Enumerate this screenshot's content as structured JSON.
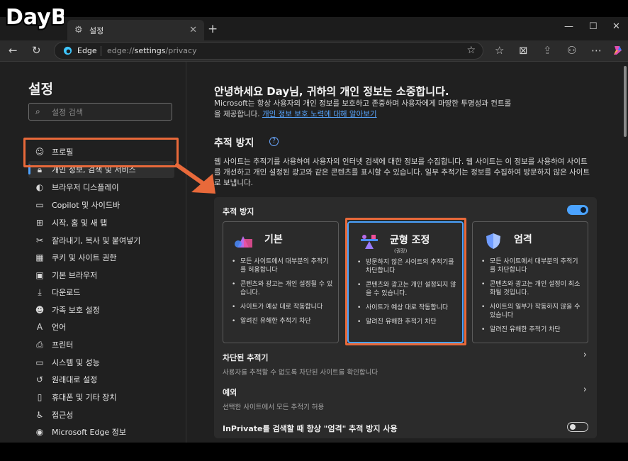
{
  "logo_text": "DayB",
  "tab": {
    "label": "설정"
  },
  "toolbar": {
    "site_name": "Edge",
    "url_prefix": "edge://",
    "url_host": "settings",
    "url_path": "/privacy"
  },
  "sidebar": {
    "title": "설정",
    "search_placeholder": "설정 검색",
    "items": [
      {
        "label": "프로필",
        "icon": "profile-icon"
      },
      {
        "label": "개인 정보, 검색 및 서비스",
        "icon": "lock-icon",
        "active": true
      },
      {
        "label": "브라우저 디스플레이",
        "icon": "palette-icon"
      },
      {
        "label": "Copilot 및 사이드바",
        "icon": "sidebar-icon"
      },
      {
        "label": "시작, 홈 및 새 탭",
        "icon": "start-icon"
      },
      {
        "label": "잘라내기, 복사 및 붙여넣기",
        "icon": "clipboard-icon"
      },
      {
        "label": "쿠키 및 사이트 권한",
        "icon": "cookie-icon"
      },
      {
        "label": "기본 브라우저",
        "icon": "browser-icon"
      },
      {
        "label": "다운로드",
        "icon": "download-icon"
      },
      {
        "label": "가족 보호 설정",
        "icon": "family-icon"
      },
      {
        "label": "언어",
        "icon": "language-icon"
      },
      {
        "label": "프린터",
        "icon": "printer-icon"
      },
      {
        "label": "시스템 및 성능",
        "icon": "system-icon"
      },
      {
        "label": "원래대로 설정",
        "icon": "reset-icon"
      },
      {
        "label": "휴대폰 및 기타 장치",
        "icon": "phone-icon"
      },
      {
        "label": "접근성",
        "icon": "accessibility-icon"
      },
      {
        "label": "Microsoft Edge 정보",
        "icon": "edge-icon"
      }
    ]
  },
  "main": {
    "heading": "안녕하세요 Day님, 귀하의 개인 정보는 소중합니다.",
    "intro": "Microsoft는 항상 사용자의 개인 정보를 보호하고 존중하며 사용자에게 마땅한 투명성과 컨트롤을 제공합니다.",
    "intro_link": "개인 정보 보호 노력에 대해 알아보기",
    "section_title": "추적 방지",
    "section_desc": "웹 사이트는 추적기를 사용하여 사용자의 인터넷 검색에 대한 정보를 수집합니다. 웹 사이트는 이 정보를 사용하여 사이트를 개선하고 개인 설정된 광고와 같은 콘텐츠를 표시할 수 있습니다. 일부 추적기는 정보를 수집하여 방문하지 않은 사이트로 보냅니다.",
    "panel_title": "추적 방지",
    "tracking_enabled": true,
    "cards": [
      {
        "title": "기본",
        "subtitle": "",
        "bullets": [
          "모든 사이트에서 대부분의 추적기를 허용합니다",
          "콘텐츠와 광고는 개인 설정될 수 있습니다.",
          "사이트가 예상 대로 작동합니다",
          "알려진 유해한 추적기 차단"
        ]
      },
      {
        "title": "균형 조정",
        "subtitle": "(권장)",
        "bullets": [
          "방문하지 않은 사이트의 추적기를 차단합니다",
          "콘텐츠와 광고는 개인 설정되지 않을 수 있습니다.",
          "사이트가 예상 대로 작동합니다",
          "알려진 유해한 추적기 차단"
        ]
      },
      {
        "title": "엄격",
        "subtitle": "",
        "bullets": [
          "모든 사이트에서 대부분의 추적기를 차단합니다",
          "콘텐츠와 광고는 개인 설정이 최소화될 것입니다.",
          "사이트의 일부가 작동하지 않을 수 있습니다",
          "알려진 유해한 추적기 차단"
        ]
      }
    ],
    "blocked_title": "차단된 추적기",
    "blocked_sub": "사용자를 추적할 수 없도록 차단된 사이트를 확인합니다",
    "exceptions_title": "예외",
    "exceptions_sub": "선택한 사이트에서 모든 추적기 허용",
    "inprivate_label": "InPrivate를 검색할 때 항상 \"엄격\" 추적 방지 사용",
    "inprivate_enabled": false
  },
  "colors": {
    "accent": "#4ba3ff",
    "annotation": "#e8693a"
  }
}
